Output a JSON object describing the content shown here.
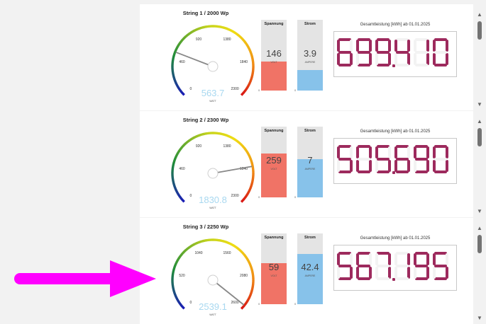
{
  "colors": {
    "voltage_bar": "#f07366",
    "current_bar": "#87c2ea",
    "gauge_value": "#a8d8f0",
    "digit_on": "#9d2a5d",
    "digit_off": "#f3f3f3",
    "needle": "#888888",
    "annotation_arrow": "#ff00ff"
  },
  "strings": [
    {
      "title": "String 1 / 2000 Wp",
      "gauge": {
        "min": 0,
        "max": 2300,
        "value": 563.7,
        "value_text": "563.7",
        "unit": "WATT",
        "ticks": [
          "0",
          "460",
          "920",
          "1380",
          "1840",
          "2300"
        ]
      },
      "voltage": {
        "title": "Spannung",
        "value": 146,
        "value_text": "146",
        "unit": "VOLT",
        "zero": "0",
        "fill_fraction": 0.41
      },
      "current": {
        "title": "Strom",
        "value": 3.9,
        "value_text": "3.9",
        "unit": "AMPERE",
        "zero": "0",
        "fill_fraction": 0.29
      },
      "energy": {
        "title": "Gesamtleistung [kWh] ab 01.01.2025",
        "digits": "699.410"
      }
    },
    {
      "title": "String 2 / 2300 Wp",
      "gauge": {
        "min": 0,
        "max": 2300,
        "value": 1830.8,
        "value_text": "1830.8",
        "unit": "WATT",
        "ticks": [
          "0",
          "460",
          "920",
          "1380",
          "1840",
          "2300"
        ]
      },
      "voltage": {
        "title": "Spannung",
        "value": 259,
        "value_text": "259",
        "unit": "VOLT",
        "zero": "0",
        "fill_fraction": 0.62
      },
      "current": {
        "title": "Strom",
        "value": 7,
        "value_text": "7",
        "unit": "AMPERE",
        "zero": "0",
        "fill_fraction": 0.54
      },
      "energy": {
        "title": "Gesamtleistung [kWh] ab 01.01.2025",
        "digits": "505.690"
      }
    },
    {
      "title": "String 3 / 2250 Wp",
      "gauge": {
        "min": 0,
        "max": 2600,
        "value": 2539.1,
        "value_text": "2539.1",
        "unit": "WATT",
        "ticks": [
          "0",
          "520",
          "1040",
          "1560",
          "2080",
          "2600"
        ]
      },
      "voltage": {
        "title": "Spannung",
        "value": 59,
        "value_text": "59",
        "unit": "VOLT",
        "zero": "0",
        "fill_fraction": 0.58
      },
      "current": {
        "title": "Strom",
        "value": 42.4,
        "value_text": "42.4",
        "unit": "AMPERE",
        "zero": "0",
        "fill_fraction": 0.71
      },
      "energy": {
        "title": "Gesamtleistung [kWh] ab 01.01.2025",
        "digits": "567.195"
      }
    }
  ],
  "scrollbar": {
    "up_icon": "chevron-up-icon",
    "down_icon": "chevron-down-icon"
  },
  "annotation": {
    "icon": "arrow-right-icon"
  }
}
